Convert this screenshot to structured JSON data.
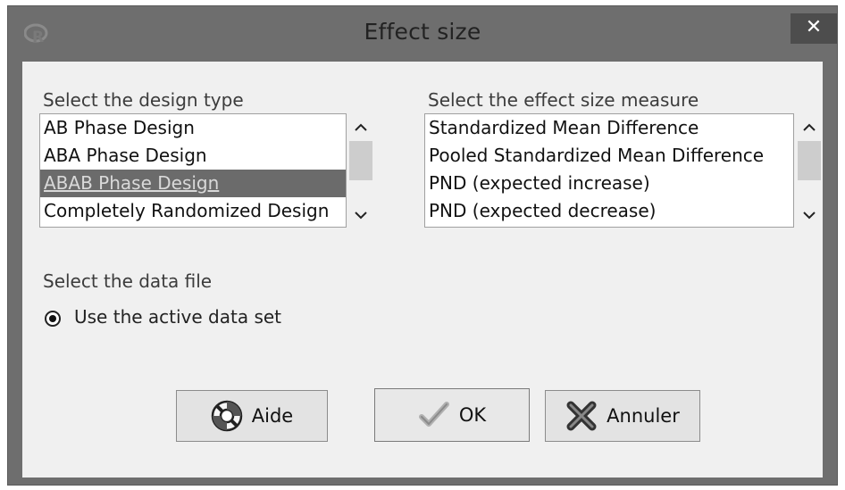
{
  "window": {
    "title": "Effect size",
    "app_icon": "r-logo-icon",
    "close_label": "✕"
  },
  "design": {
    "label": "Select the design type",
    "items": [
      "AB Phase Design",
      "ABA Phase Design",
      "ABAB Phase Design",
      "Completely Randomized Design"
    ],
    "selected_index": 2
  },
  "measure": {
    "label": "Select the effect size measure",
    "items": [
      "Standardized Mean Difference",
      "Pooled Standardized Mean Difference",
      "PND (expected increase)",
      "PND (expected decrease)"
    ]
  },
  "data_file": {
    "label": "Select the data file",
    "option": "Use the active data set",
    "checked": true
  },
  "buttons": {
    "help": "Aide",
    "ok": "OK",
    "cancel": "Annuler"
  },
  "icons": {
    "scroll_up": "▲",
    "scroll_down": "▼",
    "help_icon": "lifebuoy-icon",
    "ok_icon": "checkmark-icon",
    "cancel_icon": "x-mark-icon"
  }
}
